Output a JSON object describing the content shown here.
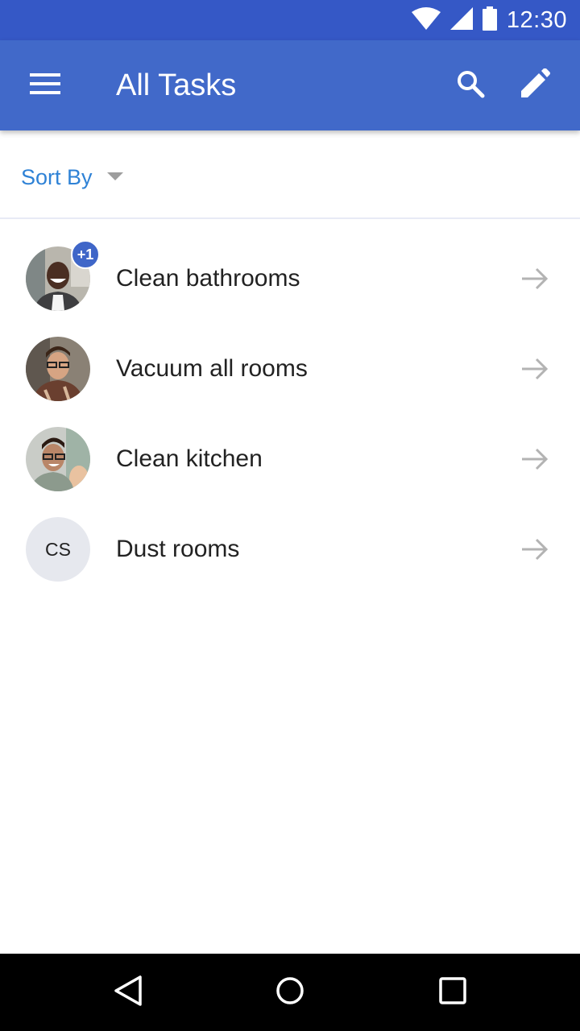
{
  "status_bar": {
    "time": "12:30",
    "icons": [
      "wifi-icon",
      "cellular-signal-icon",
      "battery-icon"
    ]
  },
  "app_bar": {
    "title": "All Tasks",
    "menu_icon": "menu-icon",
    "search_icon": "search-icon",
    "edit_icon": "edit-pencil-icon"
  },
  "sort": {
    "label": "Sort By",
    "icon": "dropdown-arrow-icon"
  },
  "tasks": [
    {
      "label": "Clean bathrooms",
      "avatar": "photo",
      "badge": "+1"
    },
    {
      "label": "Vacuum all rooms",
      "avatar": "photo"
    },
    {
      "label": "Clean kitchen",
      "avatar": "photo"
    },
    {
      "label": "Dust rooms",
      "avatar": "initials",
      "initials": "CS"
    }
  ],
  "nav_bar": {
    "icons": [
      "back-icon",
      "home-icon",
      "recents-icon"
    ]
  },
  "colors": {
    "status_bar": "#3558c6",
    "app_bar": "#4169c9",
    "accent": "#2f82d6",
    "badge": "#3f66c8",
    "text": "#222222",
    "arrow": "#b3b3b3",
    "initials_bg": "#e6e8ee"
  }
}
